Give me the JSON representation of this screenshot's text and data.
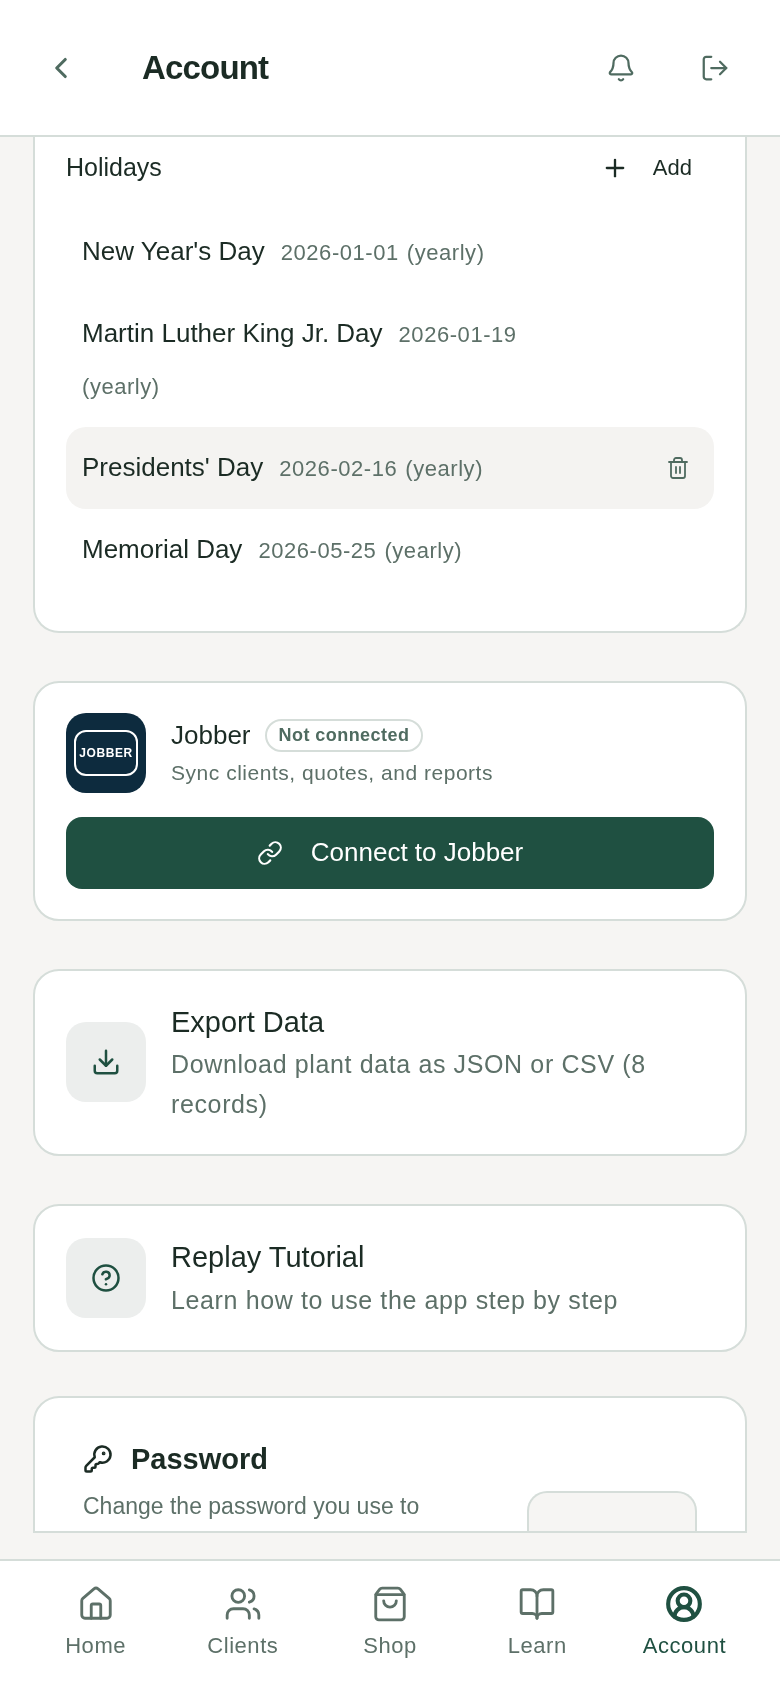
{
  "header": {
    "title": "Account"
  },
  "holidays": {
    "title": "Holidays",
    "add_label": "Add",
    "items": [
      {
        "name": "New Year's Day",
        "date": "2026-01-01",
        "repeat": "(yearly)",
        "selected": false
      },
      {
        "name": "Martin Luther King Jr. Day",
        "date": "2026-01-19",
        "repeat": "(yearly)",
        "selected": false
      },
      {
        "name": "Presidents' Day",
        "date": "2026-02-16",
        "repeat": "(yearly)",
        "selected": true
      },
      {
        "name": "Memorial Day",
        "date": "2026-05-25",
        "repeat": "(yearly)",
        "selected": false
      }
    ]
  },
  "jobber": {
    "logo_text": "JOBBER",
    "name": "Jobber",
    "status": "Not connected",
    "description": "Sync clients, quotes, and reports",
    "button": "Connect to Jobber"
  },
  "actions": [
    {
      "kind": "download",
      "title": "Export Data",
      "description": "Download plant data as JSON or CSV (8 records)"
    },
    {
      "kind": "help",
      "title": "Replay Tutorial",
      "description": "Learn how to use the app step by step"
    }
  ],
  "password": {
    "title": "Password",
    "description": "Change the password you use to"
  },
  "nav": [
    {
      "kind": "home",
      "label": "Home",
      "selected": false
    },
    {
      "kind": "clients",
      "label": "Clients",
      "selected": false
    },
    {
      "kind": "shop",
      "label": "Shop",
      "selected": false
    },
    {
      "kind": "learn",
      "label": "Learn",
      "selected": false
    },
    {
      "kind": "account",
      "label": "Account",
      "selected": true
    }
  ]
}
